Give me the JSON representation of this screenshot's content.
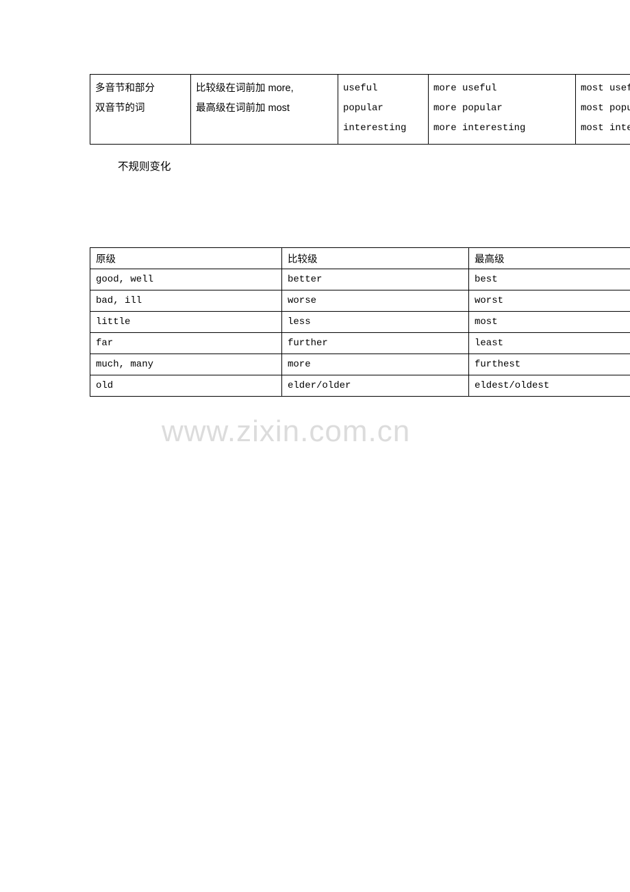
{
  "document": {
    "heading": "不规则变化",
    "watermark": "www.zixin.com.cn",
    "rules_table": {
      "rows": [
        {
          "category": [
            "多音节和部分",
            "双音节的词"
          ],
          "rule": [
            "比较级在词前加 more,",
            "最高级在词前加 most"
          ],
          "base": [
            "useful",
            "popular",
            "interesting"
          ],
          "comparative": [
            "more useful",
            "more popular",
            "more interesting"
          ],
          "superlative": [
            "most useful",
            "most popular",
            "most interesting"
          ]
        }
      ]
    },
    "irregular_table": {
      "headers": [
        "原级",
        "比较级",
        "最高级"
      ],
      "rows": [
        [
          "good, well",
          "better",
          "best"
        ],
        [
          "bad, ill",
          "worse",
          "worst"
        ],
        [
          "little",
          "less",
          "most"
        ],
        [
          "far",
          "further",
          "least"
        ],
        [
          "much, many",
          "more",
          "furthest"
        ],
        [
          "old",
          "elder/older",
          "eldest/oldest"
        ]
      ]
    }
  }
}
